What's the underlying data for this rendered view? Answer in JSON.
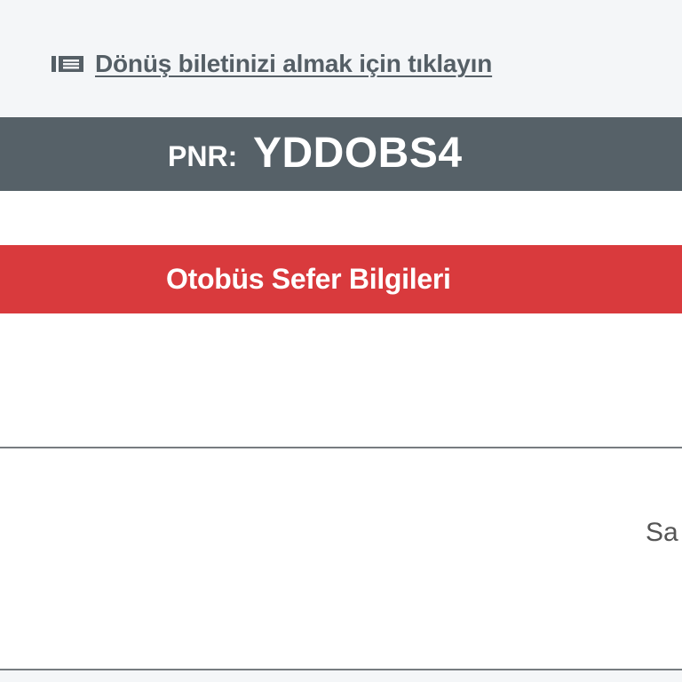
{
  "return_ticket": {
    "link_label": "Dönüş biletinizi almak için tıklayın",
    "icon": "ticket-icon"
  },
  "pnr": {
    "prefix": "PNR:",
    "code": "YDDOBS4"
  },
  "bus_info": {
    "title": "Otobüs Sefer Bilgileri"
  },
  "cut_off_text": "Sa",
  "colors": {
    "pnr_bar": "#566168",
    "section_header": "#d93a3d",
    "link_text": "#555f66",
    "top_background": "#f4f6f8"
  }
}
